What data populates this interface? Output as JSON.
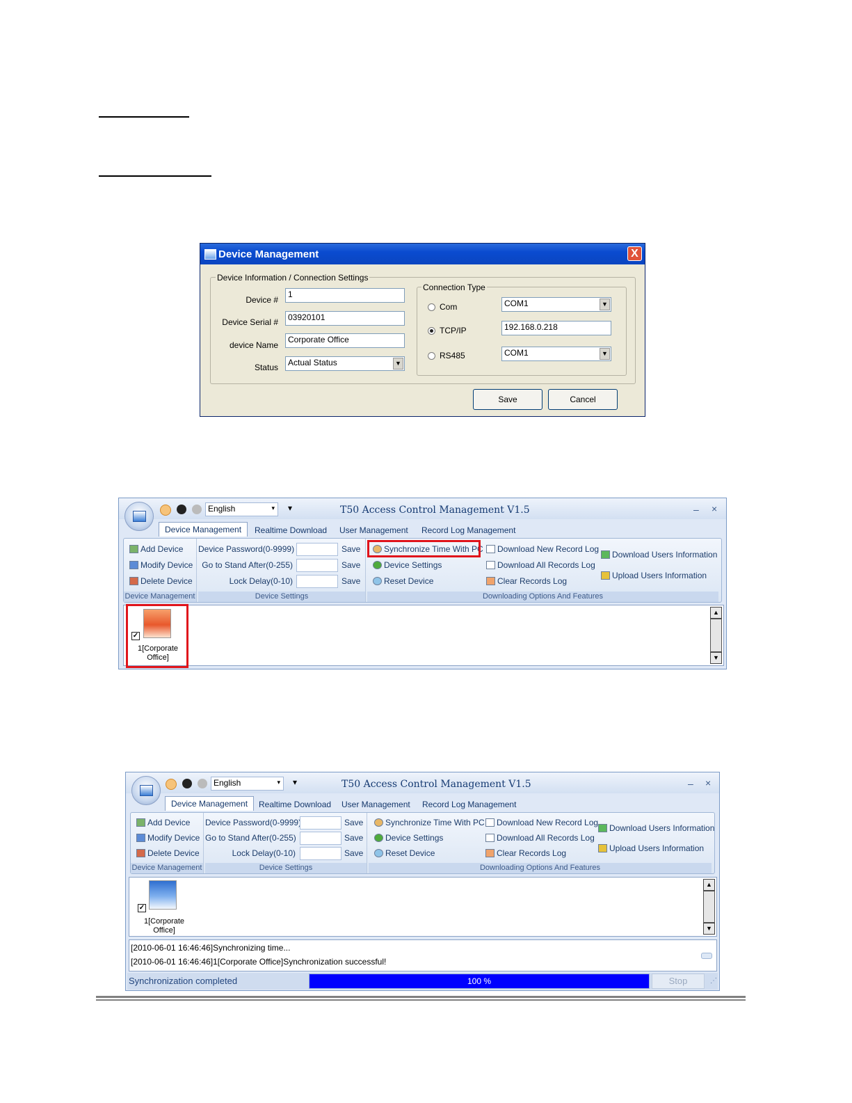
{
  "dialog": {
    "title": "Device Management",
    "close": "X",
    "group_info": "Device Information / Connection Settings",
    "labels": {
      "device_no": "Device #",
      "serial": "Device Serial #",
      "name": "device Name",
      "status": "Status"
    },
    "values": {
      "device_no": "1",
      "serial": "03920101",
      "name": "Corporate Office",
      "status": "Actual Status"
    },
    "conn_group": "Connection Type",
    "conn": {
      "com": "Com",
      "tcpip": "TCP/IP",
      "rs485": "RS485",
      "com_port": "COM1",
      "ip": "192.168.0.218",
      "rs485_port": "COM1",
      "selected": "TCP/IP"
    },
    "save": "Save",
    "cancel": "Cancel"
  },
  "app": {
    "language": "English",
    "title": "T50 Access Control Management V1.5",
    "minimize": "–",
    "close": "×",
    "tabs": [
      "Device Management",
      "Realtime Download",
      "User Management",
      "Record Log Management"
    ],
    "device_mgmt": {
      "add": "Add Device",
      "modify": "Modify Device",
      "delete": "Delete Device",
      "label": "Device Management"
    },
    "device_settings": {
      "password": "Device Password(0-9999)",
      "standby": "Go to Stand After(0-255)",
      "lock": "Lock Delay(0-10)",
      "save": "Save",
      "label": "Device Settings"
    },
    "downloads": {
      "sync": "Synchronize Time With PC",
      "settings": "Device Settings",
      "reset": "Reset Device",
      "new_log": "Download New Record Log",
      "all_log": "Download All Records Log",
      "clear_log": "Clear Records Log",
      "dl_users": "Download Users Information",
      "ul_users": "Upload Users Information",
      "label": "Downloading Options And Features"
    },
    "device_item": {
      "line1": "1[Corporate",
      "line2": "Office]"
    },
    "log_lines": [
      "[2010-06-01 16:46:46]Synchronizing time...",
      "[2010-06-01 16:46:46]1[Corporate Office]Synchronization successful!"
    ],
    "status_text": "Synchronization completed",
    "progress_label": "100 %",
    "progress_value": 1.0,
    "stop": "Stop"
  },
  "colors": {
    "highlight": "#e0141b",
    "progress": "#0000ff",
    "titlebar": "#0a4bd0"
  }
}
